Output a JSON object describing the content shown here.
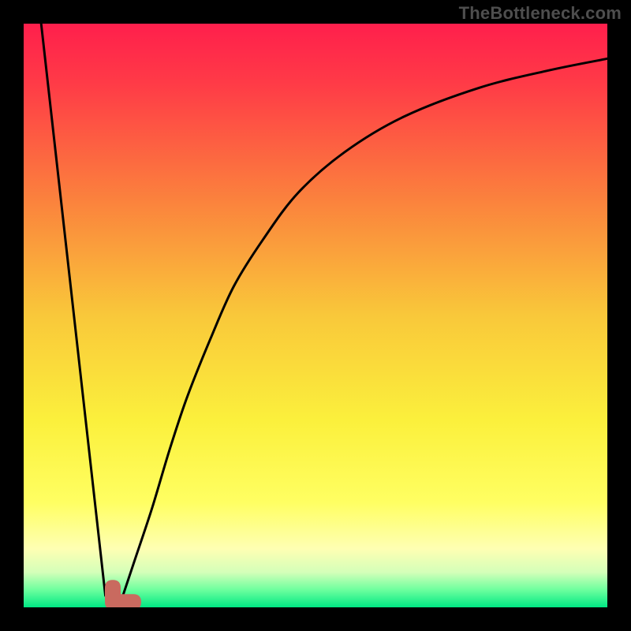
{
  "watermark": "TheBottleneck.com",
  "chart_data": {
    "type": "line",
    "title": "",
    "xlabel": "",
    "ylabel": "",
    "xlim": [
      0,
      100
    ],
    "ylim": [
      0,
      100
    ],
    "grid": false,
    "background_gradient": [
      {
        "pos": 0.0,
        "color": "#ff1f4c"
      },
      {
        "pos": 0.1,
        "color": "#ff3a47"
      },
      {
        "pos": 0.3,
        "color": "#fb813d"
      },
      {
        "pos": 0.5,
        "color": "#f9c83a"
      },
      {
        "pos": 0.68,
        "color": "#fbf03c"
      },
      {
        "pos": 0.82,
        "color": "#ffff62"
      },
      {
        "pos": 0.9,
        "color": "#feffb3"
      },
      {
        "pos": 0.94,
        "color": "#d4ffb9"
      },
      {
        "pos": 0.97,
        "color": "#6dff9e"
      },
      {
        "pos": 1.0,
        "color": "#00e884"
      }
    ],
    "marker": {
      "shape": "L",
      "color": "#c96a5f",
      "x": 15,
      "y": 2,
      "approx_percent_x": 15,
      "approx_percent_y": 2
    },
    "series": [
      {
        "name": "left_leg",
        "x": [
          3.0,
          14.0
        ],
        "y": [
          100.0,
          2.0
        ]
      },
      {
        "name": "right_curve",
        "x": [
          17,
          19,
          22,
          25,
          28,
          32,
          36,
          41,
          47,
          55,
          65,
          78,
          90,
          100
        ],
        "y": [
          2,
          8,
          17,
          27,
          36,
          46,
          55,
          63,
          71,
          78,
          84,
          89,
          92,
          94
        ]
      }
    ]
  }
}
